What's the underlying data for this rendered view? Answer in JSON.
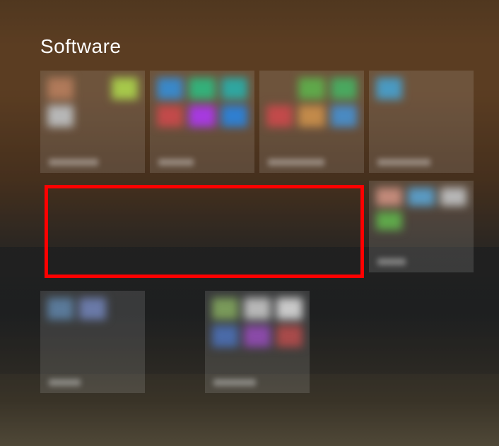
{
  "group_title": "Software",
  "tiles": {
    "t1": {
      "label_width": 70
    },
    "t2": {
      "label_width": 50
    },
    "t3": {
      "label_width": 80
    },
    "t4": {
      "label_width": 75
    },
    "t5": {
      "label_width": 40
    },
    "t6": {
      "label_width": 45
    },
    "t7": {
      "label_width": 60
    }
  },
  "highlight_color": "#ff0000"
}
